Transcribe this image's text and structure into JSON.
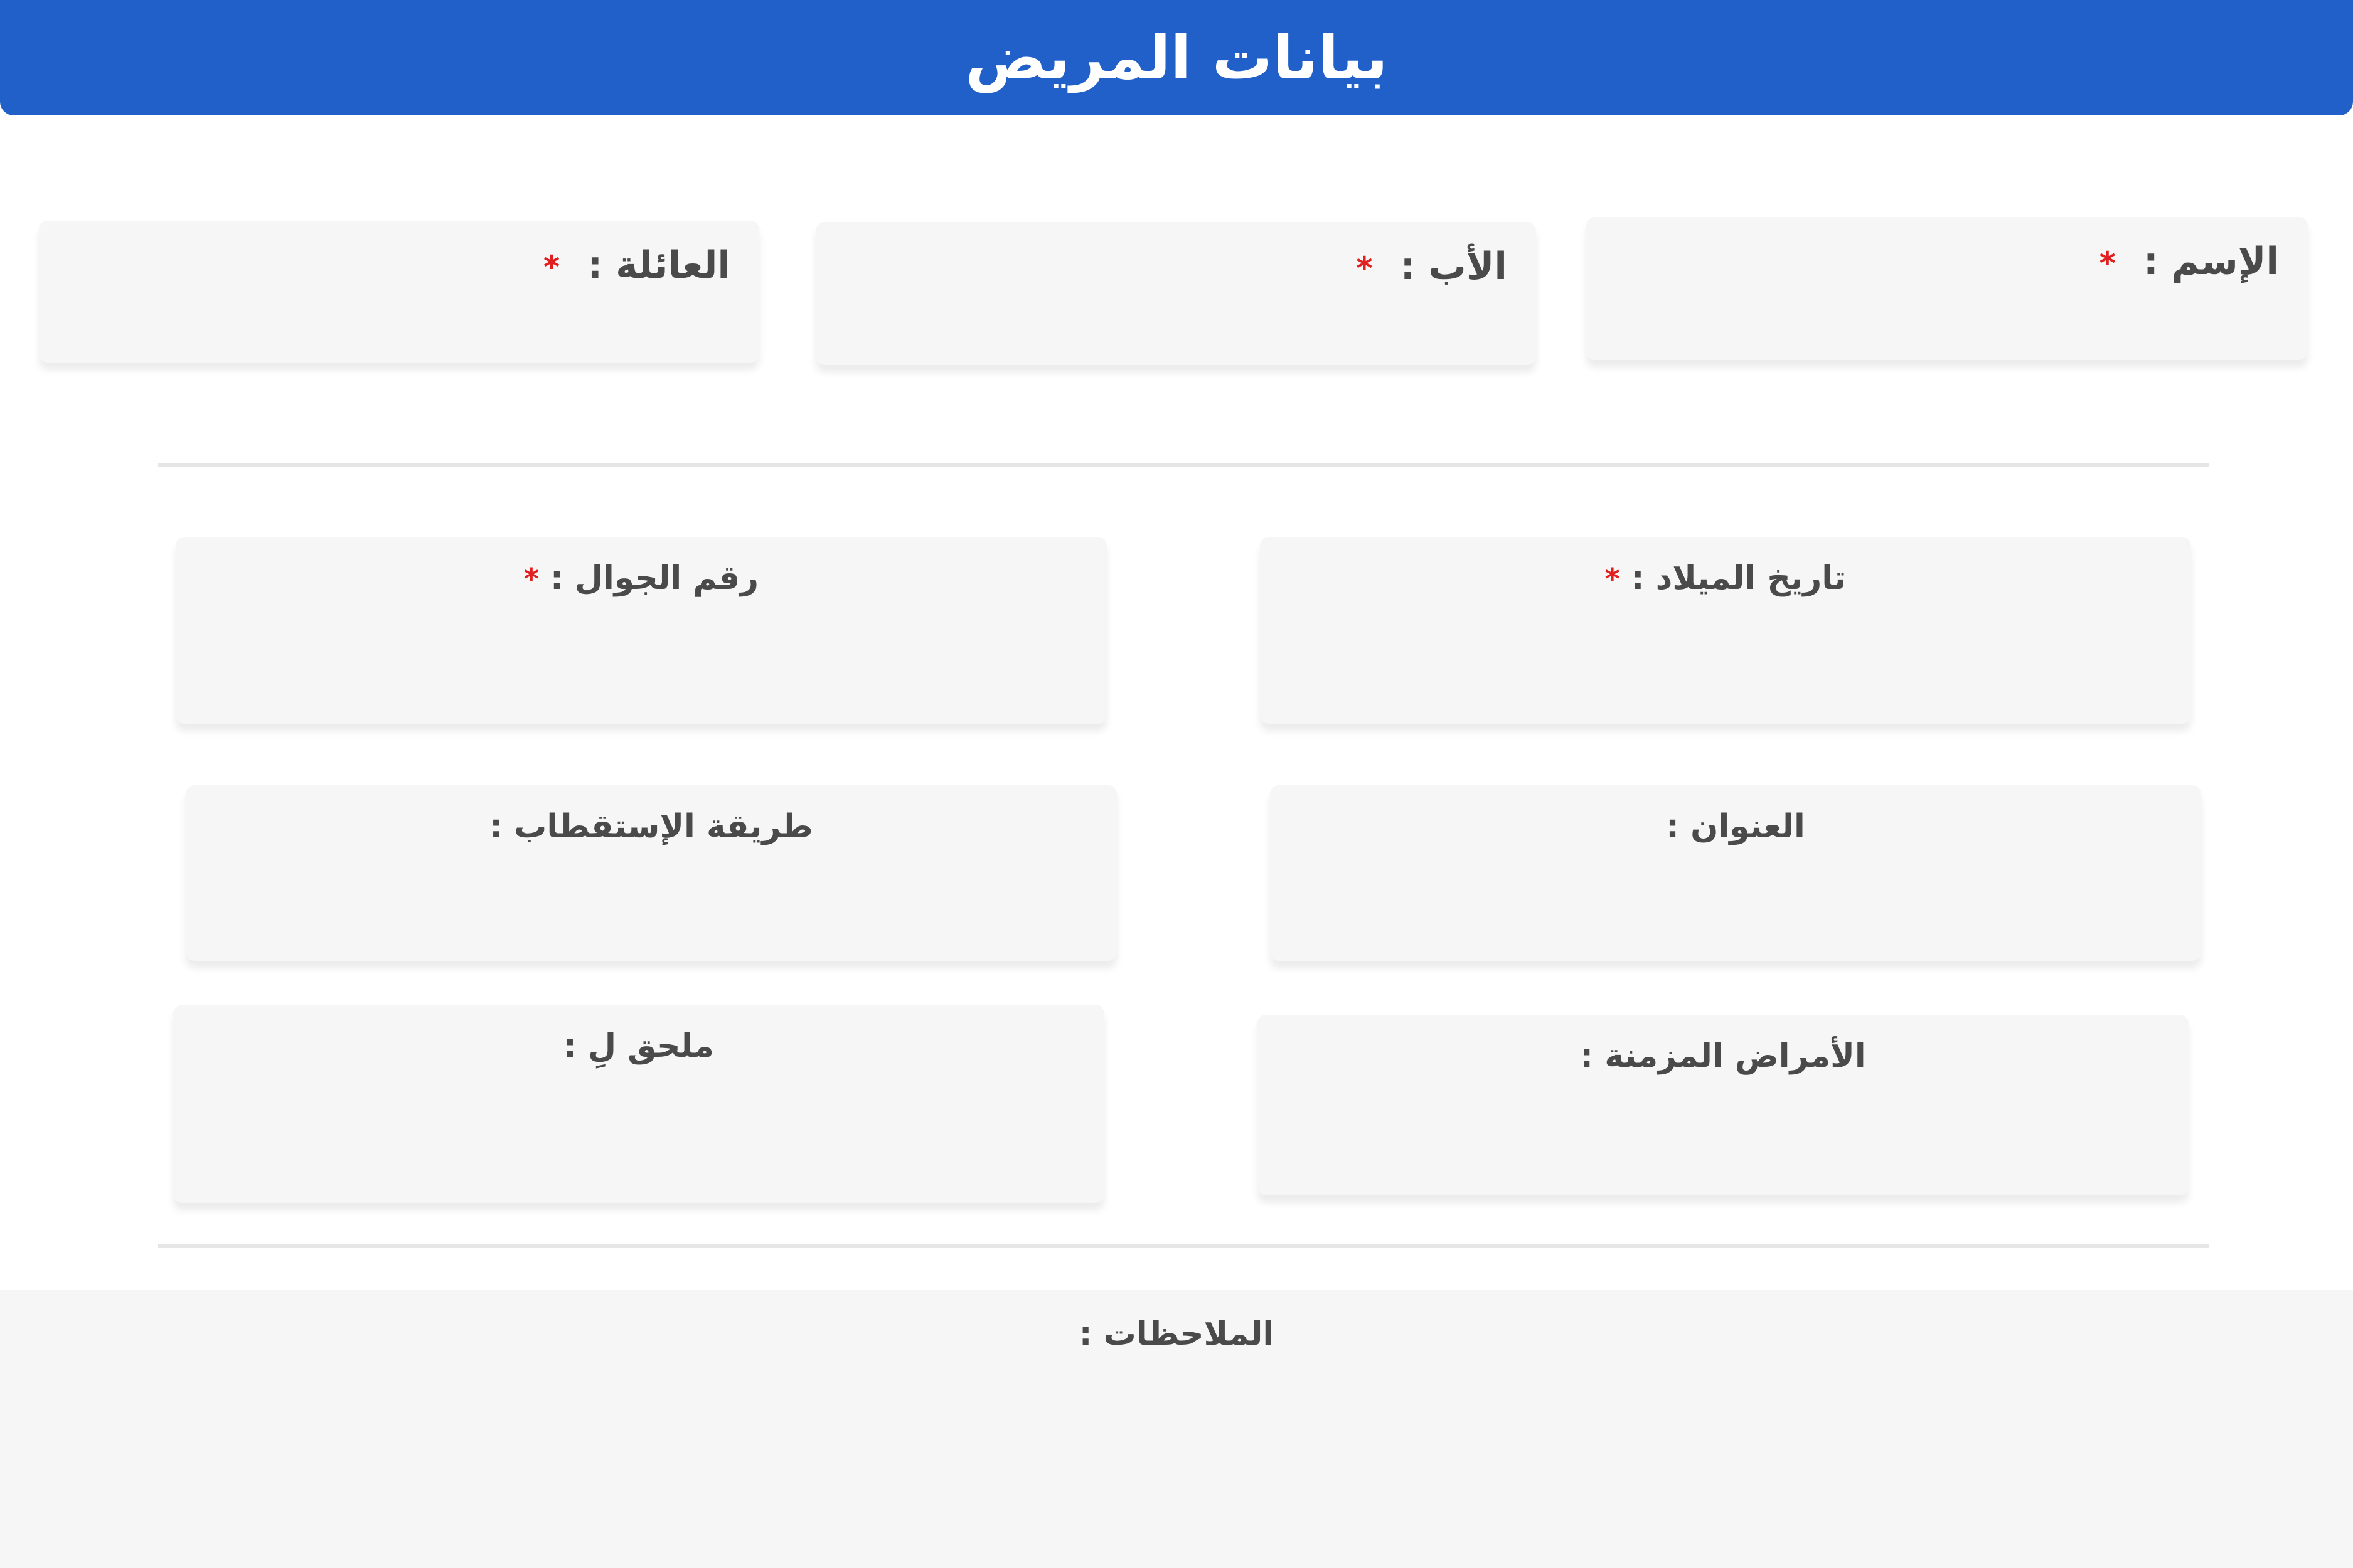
{
  "header": {
    "title": "بيانات المريض"
  },
  "fields": {
    "first_name": {
      "label": "الإسم :",
      "required_mark": "*"
    },
    "father_name": {
      "label": "الأب :",
      "required_mark": "*"
    },
    "family_name": {
      "label": "العائلة :",
      "required_mark": "*"
    },
    "birth_date": {
      "label": "تاريخ الميلاد :",
      "required_mark": "*"
    },
    "mobile": {
      "label": "رقم الجوال :",
      "required_mark": "*"
    },
    "address": {
      "label": "العنوان :"
    },
    "referral_method": {
      "label": "طريقة الإستقطاب :"
    },
    "chronic_diseases": {
      "label": "الأمراض المزمنة :"
    },
    "attached_to": {
      "label": "ملحق لِ :"
    },
    "notes": {
      "label": "الملاحظات :"
    }
  },
  "colors": {
    "header_bg": "#2160c8",
    "required": "#e21f1f",
    "field_bg": "#f6f6f6"
  }
}
